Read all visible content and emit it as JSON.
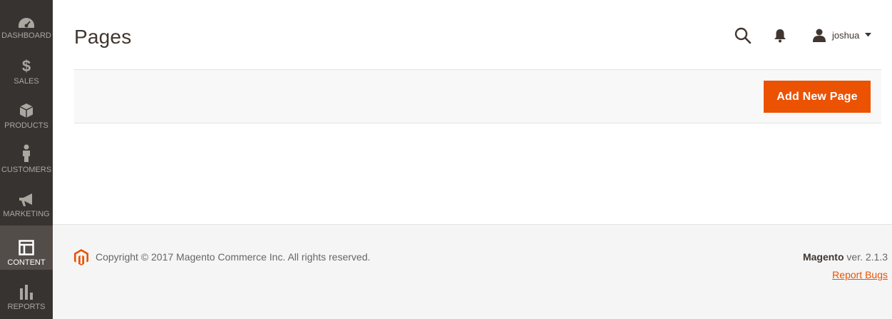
{
  "sidebar": {
    "items": [
      {
        "label": "Dashboard",
        "icon": "dashboard-icon",
        "active": false
      },
      {
        "label": "Sales",
        "icon": "dollar-icon",
        "active": false
      },
      {
        "label": "Products",
        "icon": "box-icon",
        "active": false
      },
      {
        "label": "Customers",
        "icon": "person-icon",
        "active": false
      },
      {
        "label": "Marketing",
        "icon": "megaphone-icon",
        "active": false
      },
      {
        "label": "Content",
        "icon": "layout-icon",
        "active": true
      },
      {
        "label": "Reports",
        "icon": "bar-chart-icon",
        "active": false
      }
    ]
  },
  "header": {
    "title": "Pages",
    "user_name": "joshua"
  },
  "actions": {
    "add_new_page_label": "Add New Page"
  },
  "footer": {
    "copyright": "Copyright © 2017 Magento Commerce Inc. All rights reserved.",
    "brand": "Magento",
    "version": " ver. 2.1.3",
    "report_bugs": "Report Bugs"
  },
  "colors": {
    "accent": "#eb5202",
    "sidebar_bg": "#373330",
    "sidebar_active": "#524d49"
  }
}
